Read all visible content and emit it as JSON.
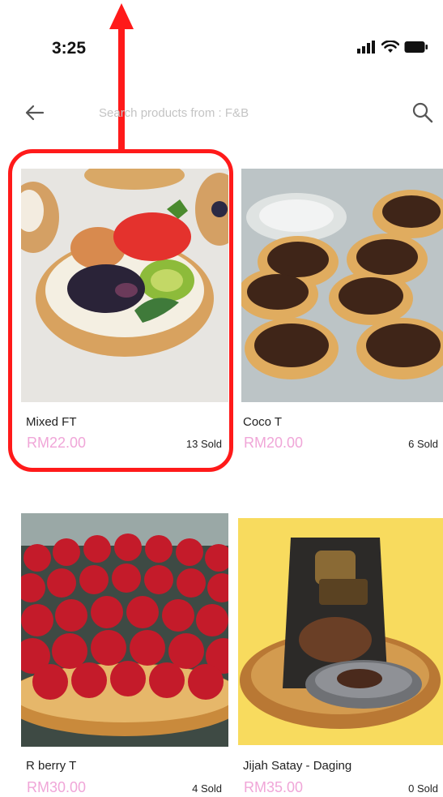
{
  "status_bar": {
    "time": "3:25",
    "icons": [
      "signal-icon",
      "wifi-icon",
      "battery-icon"
    ]
  },
  "search": {
    "placeholder": "Search products from : F&B",
    "value": ""
  },
  "theme": {
    "price_color": "#f0a6d8",
    "annotation_color": "#ff1a1a"
  },
  "products": [
    {
      "name": "Mixed FT",
      "price": "RM22.00",
      "sold": "13 Sold"
    },
    {
      "name": "Coco T",
      "price": "RM20.00",
      "sold": "6 Sold"
    },
    {
      "name": "R berry T",
      "price": "RM30.00",
      "sold": "4 Sold"
    },
    {
      "name": "Jijah Satay - Daging",
      "price": "RM35.00",
      "sold": "0 Sold"
    }
  ]
}
